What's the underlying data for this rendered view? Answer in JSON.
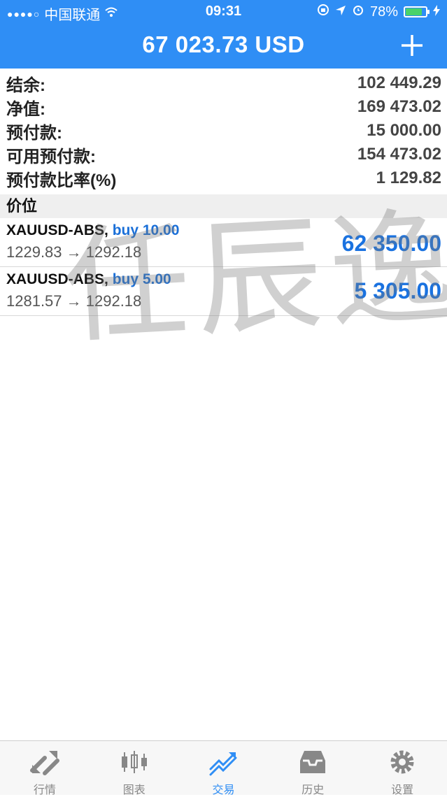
{
  "status_bar": {
    "signal": "●●●●○",
    "carrier": "中国联通",
    "time": "09:31",
    "battery_percent": "78%"
  },
  "header": {
    "title": "67 023.73 USD",
    "add_icon": "plus-icon"
  },
  "summary": [
    {
      "label": "结余:",
      "value": "102 449.29"
    },
    {
      "label": "净值:",
      "value": "169 473.02"
    },
    {
      "label": "预付款:",
      "value": "15 000.00"
    },
    {
      "label": "可用预付款:",
      "value": "154 473.02"
    },
    {
      "label": "预付款比率(%)",
      "value": "1 129.82"
    }
  ],
  "section_title": "价位",
  "positions": [
    {
      "symbol": "XAUUSD-ABS,",
      "direction": "buy 10.00",
      "prices": "1229.83 → 1292.18",
      "profit": "62 350.00"
    },
    {
      "symbol": "XAUUSD-ABS,",
      "direction": "buy 5.00",
      "prices": "1281.57 → 1292.18",
      "profit": "5 305.00"
    }
  ],
  "watermark": "任辰逸",
  "tabs": [
    {
      "label": "行情",
      "icon": "quotes-icon",
      "active": false
    },
    {
      "label": "图表",
      "icon": "chart-icon",
      "active": false
    },
    {
      "label": "交易",
      "icon": "trade-icon",
      "active": true
    },
    {
      "label": "历史",
      "icon": "history-icon",
      "active": false
    },
    {
      "label": "设置",
      "icon": "settings-icon",
      "active": false
    }
  ],
  "colors": {
    "header_bg": "#2f8ef5",
    "profit": "#1a72e0",
    "buy": "#1a6fd8",
    "battery": "#49d26a"
  }
}
